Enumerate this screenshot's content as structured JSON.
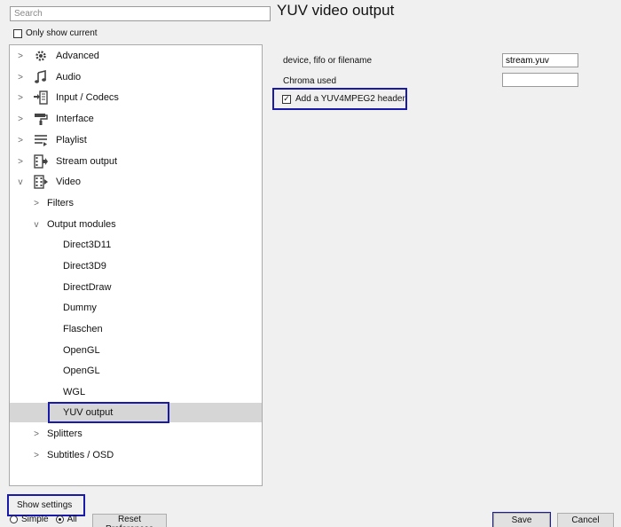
{
  "search": {
    "placeholder": "Search"
  },
  "only_show_current": {
    "label": "Only show current",
    "checked": false
  },
  "tree": {
    "items": [
      {
        "label": "Advanced",
        "icon": "gear-icon",
        "expand": ">"
      },
      {
        "label": "Audio",
        "icon": "music-note-icon",
        "expand": ">"
      },
      {
        "label": "Input / Codecs",
        "icon": "input-codecs-icon",
        "expand": ">"
      },
      {
        "label": "Interface",
        "icon": "paint-roller-icon",
        "expand": ">"
      },
      {
        "label": "Playlist",
        "icon": "playlist-icon",
        "expand": ">"
      },
      {
        "label": "Stream output",
        "icon": "stream-output-icon",
        "expand": ">"
      },
      {
        "label": "Video",
        "icon": "video-icon",
        "expand": "v"
      },
      {
        "label": "Filters",
        "expand": ">"
      },
      {
        "label": "Output modules",
        "expand": "v"
      },
      {
        "label": "Direct3D11"
      },
      {
        "label": "Direct3D9"
      },
      {
        "label": "DirectDraw"
      },
      {
        "label": "Dummy"
      },
      {
        "label": "Flaschen"
      },
      {
        "label": "OpenGL"
      },
      {
        "label": "OpenGL"
      },
      {
        "label": "WGL"
      },
      {
        "label": "YUV output",
        "selected": true
      },
      {
        "label": "Splitters",
        "expand": ">"
      },
      {
        "label": "Subtitles / OSD",
        "expand": ">"
      }
    ]
  },
  "panel": {
    "title": "YUV video output",
    "fields": {
      "filename_label": "device, fifo or filename",
      "filename_value": "stream.yuv",
      "chroma_label": "Chroma used",
      "chroma_value": ""
    },
    "yuv4mpeg2": {
      "label": "Add a YUV4MPEG2 header",
      "checked": true
    }
  },
  "bottom": {
    "show_settings_label": "Show settings",
    "simple_label": "Simple",
    "all_label": "All",
    "selected_mode": "All",
    "reset_label": "Reset Preferences",
    "save_label": "Save",
    "cancel_label": "Cancel"
  },
  "colors": {
    "highlight": "#1a1aa8",
    "selected_row": "#d6d6d6",
    "background": "#f0f0f0"
  }
}
